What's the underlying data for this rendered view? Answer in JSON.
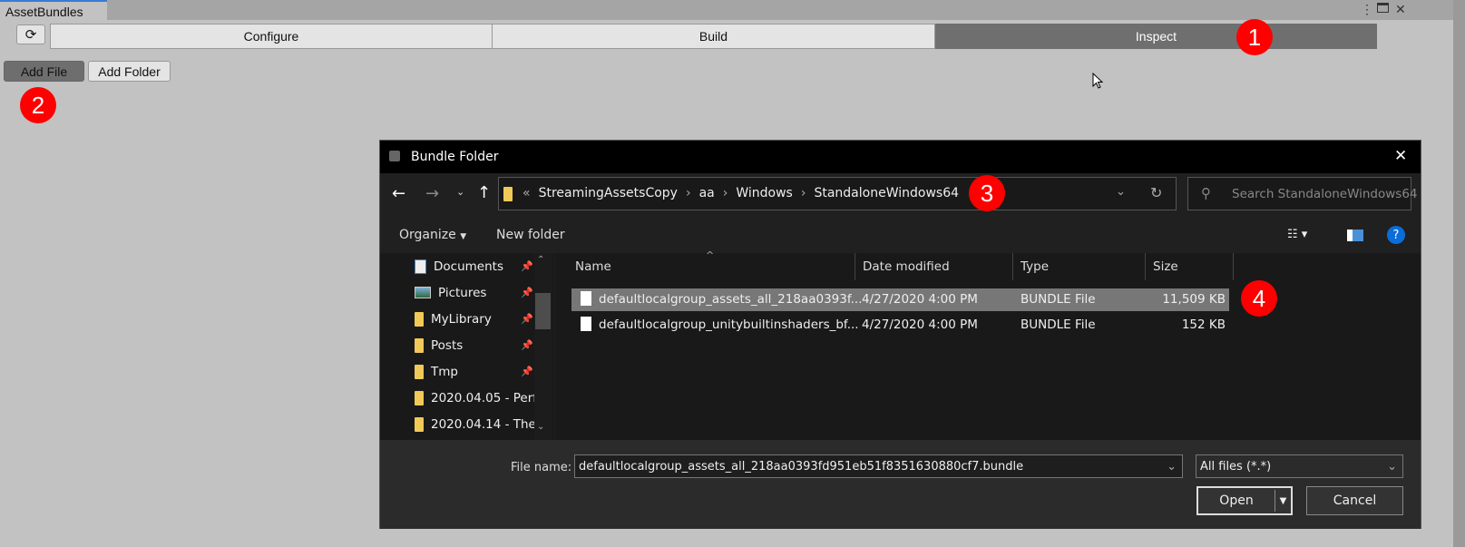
{
  "window": {
    "tab_title": "AssetBundles",
    "menu_icon": "kebab-icon",
    "maximize_icon": "maximize-icon",
    "close_icon": "close-icon"
  },
  "toolbar": {
    "refresh_icon": "refresh-icon",
    "tabs": [
      {
        "label": "Configure",
        "active": false
      },
      {
        "label": "Build",
        "active": false
      },
      {
        "label": "Inspect",
        "active": true
      }
    ]
  },
  "actions": {
    "add_file": "Add File",
    "add_folder": "Add Folder"
  },
  "annotations": [
    "1",
    "2",
    "3",
    "4"
  ],
  "annotation_color": "#ff0000",
  "dialog": {
    "title": "Bundle Folder",
    "close_icon": "close-icon",
    "breadcrumb": {
      "overflow": "«",
      "items": [
        "StreamingAssetsCopy",
        "aa",
        "Windows",
        "StandaloneWindows64"
      ]
    },
    "search_placeholder": "Search StandaloneWindows64",
    "organize": "Organize",
    "new_folder": "New folder",
    "nav": [
      {
        "label": "Documents",
        "icon": "documents-icon",
        "pinned": true
      },
      {
        "label": "Pictures",
        "icon": "pictures-icon",
        "pinned": true
      },
      {
        "label": "MyLibrary",
        "icon": "folder-icon",
        "pinned": true
      },
      {
        "label": "Posts",
        "icon": "folder-icon",
        "pinned": true
      },
      {
        "label": "Tmp",
        "icon": "folder-icon",
        "pinned": true
      },
      {
        "label": "2020.04.05 - Perf",
        "icon": "folder-icon",
        "pinned": false
      },
      {
        "label": "2020.04.14 - The",
        "icon": "folder-icon",
        "pinned": false
      }
    ],
    "columns": [
      "Name",
      "Date modified",
      "Type",
      "Size"
    ],
    "files": [
      {
        "name": "defaultlocalgroup_assets_all_218aa0393f...",
        "date": "4/27/2020 4:00 PM",
        "type": "BUNDLE File",
        "size": "11,509 KB",
        "selected": true
      },
      {
        "name": "defaultlocalgroup_unitybuiltinshaders_bf...",
        "date": "4/27/2020 4:00 PM",
        "type": "BUNDLE File",
        "size": "152 KB",
        "selected": false
      }
    ],
    "file_name_label": "File name:",
    "file_name_value": "defaultlocalgroup_assets_all_218aa0393fd951eb51f8351630880cf7.bundle",
    "filter": "All files (*.*)",
    "open": "Open",
    "cancel": "Cancel"
  }
}
